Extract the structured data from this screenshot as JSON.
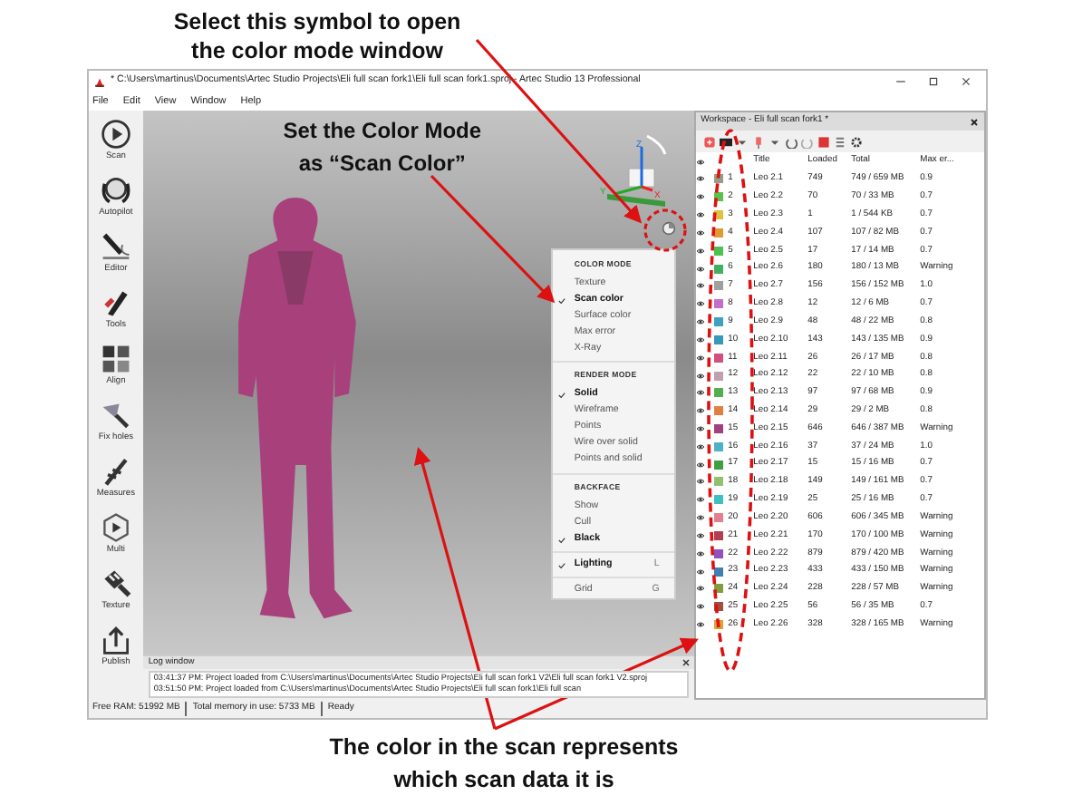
{
  "top_callout": {
    "lines": [
      "Select this symbol to open",
      "the color mode window"
    ]
  },
  "window": {
    "title": "* C:\\Users\\martinus\\Documents\\Artec Studio Projects\\Eli full scan fork1\\Eli full scan fork1.sproj - Artec Studio 13 Professional",
    "menu": [
      "File",
      "Edit",
      "View",
      "Window",
      "Help"
    ],
    "tools": [
      {
        "label": "Scan"
      },
      {
        "label": "Autopilot"
      },
      {
        "label": "Editor"
      },
      {
        "label": "Tools"
      },
      {
        "label": "Align"
      },
      {
        "label": "Fix holes"
      },
      {
        "label": "Measures"
      },
      {
        "label": "Multi"
      },
      {
        "label": "Texture"
      },
      {
        "label": "Publish"
      }
    ],
    "viewport": {
      "callout": [
        "Set the Color Mode",
        "as “Scan Color”"
      ],
      "axes": {
        "z": "Z",
        "y": "Y",
        "x": "X"
      },
      "menu": [
        {
          "heading": "COLOR MODE",
          "items": [
            {
              "label": "Texture",
              "checked": false
            },
            {
              "label": "Scan color",
              "checked": true
            },
            {
              "label": "Surface color",
              "checked": false
            },
            {
              "label": "Max error",
              "checked": false
            },
            {
              "label": "X-Ray",
              "checked": false
            }
          ]
        },
        {
          "heading": "RENDER MODE",
          "items": [
            {
              "label": "Solid",
              "checked": true
            },
            {
              "label": "Wireframe",
              "checked": false
            },
            {
              "label": "Points",
              "checked": false
            },
            {
              "label": "Wire over solid",
              "checked": false
            },
            {
              "label": "Points and solid",
              "checked": false
            }
          ]
        },
        {
          "heading": "BACKFACE",
          "items": [
            {
              "label": "Show",
              "checked": false
            },
            {
              "label": "Cull",
              "checked": false
            },
            {
              "label": "Black",
              "checked": true
            }
          ]
        },
        {
          "items": [
            {
              "label": "Lighting",
              "checked": true,
              "shortcut": "L"
            }
          ]
        },
        {
          "items": [
            {
              "label": "Grid",
              "checked": false,
              "shortcut": "G"
            }
          ]
        }
      ]
    },
    "log": {
      "title": "Log window",
      "lines": [
        "03:41:37 PM: Project loaded from C:\\Users\\martinus\\Documents\\Artec Studio Projects\\Eli full scan fork1 V2\\Eli full scan fork1 V2.sproj",
        "03:51:50 PM: Project loaded from C:\\Users\\martinus\\Documents\\Artec Studio Projects\\Eli full scan fork1\\Eli full scan"
      ]
    },
    "workspace": {
      "title": "Workspace - Eli full scan fork1 *",
      "columns": [
        "Title",
        "Loaded",
        "Total",
        "Max er..."
      ],
      "rows": [
        {
          "number": "1",
          "title": "Leo 2.1",
          "loaded": "749",
          "total": "749 / 659 MB",
          "max_error": "0.9",
          "color": "#9a9a8a"
        },
        {
          "number": "2",
          "title": "Leo 2.2",
          "loaded": "70",
          "total": "70 / 33 MB",
          "max_error": "0.7",
          "color": "#5cc04c"
        },
        {
          "number": "3",
          "title": "Leo 2.3",
          "loaded": "1",
          "total": "1 / 544 KB",
          "max_error": "0.7",
          "color": "#e0c040"
        },
        {
          "number": "4",
          "title": "Leo 2.4",
          "loaded": "107",
          "total": "107 / 82 MB",
          "max_error": "0.7",
          "color": "#e09a30"
        },
        {
          "number": "5",
          "title": "Leo 2.5",
          "loaded": "17",
          "total": "17 / 14 MB",
          "max_error": "0.7",
          "color": "#4cc050"
        },
        {
          "number": "6",
          "title": "Leo 2.6",
          "loaded": "180",
          "total": "180 / 13 MB",
          "max_error": "Warning",
          "color": "#40b060"
        },
        {
          "number": "7",
          "title": "Leo 2.7",
          "loaded": "156",
          "total": "156 / 152 MB",
          "max_error": "1.0",
          "color": "#a0a0a0"
        },
        {
          "number": "8",
          "title": "Leo 2.8",
          "loaded": "12",
          "total": "12 / 6 MB",
          "max_error": "0.7",
          "color": "#c070c8"
        },
        {
          "number": "9",
          "title": "Leo 2.9",
          "loaded": "48",
          "total": "48 / 22 MB",
          "max_error": "0.8",
          "color": "#40a0c0"
        },
        {
          "number": "10",
          "title": "Leo 2.10",
          "loaded": "143",
          "total": "143 / 135 MB",
          "max_error": "0.9",
          "color": "#3898b8"
        },
        {
          "number": "11",
          "title": "Leo 2.11",
          "loaded": "26",
          "total": "26 / 17 MB",
          "max_error": "0.8",
          "color": "#d05080"
        },
        {
          "number": "12",
          "title": "Leo 2.12",
          "loaded": "22",
          "total": "22 / 10 MB",
          "max_error": "0.8",
          "color": "#c0a0b0"
        },
        {
          "number": "13",
          "title": "Leo 2.13",
          "loaded": "97",
          "total": "97 / 68 MB",
          "max_error": "0.9",
          "color": "#50b050"
        },
        {
          "number": "14",
          "title": "Leo 2.14",
          "loaded": "29",
          "total": "29 / 2 MB",
          "max_error": "0.8",
          "color": "#e08040"
        },
        {
          "number": "15",
          "title": "Leo 2.15",
          "loaded": "646",
          "total": "646 / 387 MB",
          "max_error": "Warning",
          "color": "#a04080"
        },
        {
          "number": "16",
          "title": "Leo 2.16",
          "loaded": "37",
          "total": "37 / 24 MB",
          "max_error": "1.0",
          "color": "#50b0c8"
        },
        {
          "number": "17",
          "title": "Leo 2.17",
          "loaded": "15",
          "total": "15 / 16 MB",
          "max_error": "0.7",
          "color": "#40a040"
        },
        {
          "number": "18",
          "title": "Leo 2.18",
          "loaded": "149",
          "total": "149 / 161 MB",
          "max_error": "0.7",
          "color": "#90c070"
        },
        {
          "number": "19",
          "title": "Leo 2.19",
          "loaded": "25",
          "total": "25 / 16 MB",
          "max_error": "0.7",
          "color": "#40c0c0"
        },
        {
          "number": "20",
          "title": "Leo 2.20",
          "loaded": "606",
          "total": "606 / 345 MB",
          "max_error": "Warning",
          "color": "#e08090"
        },
        {
          "number": "21",
          "title": "Leo 2.21",
          "loaded": "170",
          "total": "170 / 100 MB",
          "max_error": "Warning",
          "color": "#b04050"
        },
        {
          "number": "22",
          "title": "Leo 2.22",
          "loaded": "879",
          "total": "879 / 420 MB",
          "max_error": "Warning",
          "color": "#9050c0"
        },
        {
          "number": "23",
          "title": "Leo 2.23",
          "loaded": "433",
          "total": "433 / 150 MB",
          "max_error": "Warning",
          "color": "#4080b0"
        },
        {
          "number": "24",
          "title": "Leo 2.24",
          "loaded": "228",
          "total": "228 / 57 MB",
          "max_error": "Warning",
          "color": "#80a040"
        },
        {
          "number": "25",
          "title": "Leo 2.25",
          "loaded": "56",
          "total": "56 / 35 MB",
          "max_error": "0.7",
          "color": "#a05040"
        },
        {
          "number": "26",
          "title": "Leo 2.26",
          "loaded": "328",
          "total": "328 / 165 MB",
          "max_error": "Warning",
          "color": "#e0a030"
        }
      ]
    },
    "status_bar": [
      "Free RAM: 51992 MB",
      "Total memory in use: 5733 MB",
      "Ready"
    ]
  },
  "bottom_callout": {
    "lines": [
      "The color in the scan represents",
      "which scan data it is"
    ]
  }
}
